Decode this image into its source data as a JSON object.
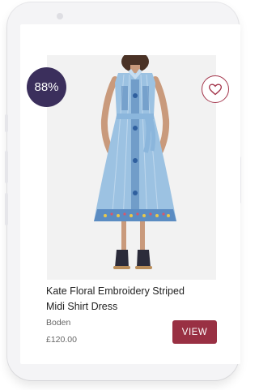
{
  "card": {
    "match_score": "88%",
    "product_title": "Kate Floral Embroidery Striped Midi Shirt Dress",
    "brand": "Boden",
    "price": "£120.00",
    "view_label": "VIEW"
  },
  "icons": {
    "wishlist": "heart-icon"
  },
  "colors": {
    "badge": "#3b2f5c",
    "accent": "#993043",
    "dress": "#9cc2e2"
  }
}
